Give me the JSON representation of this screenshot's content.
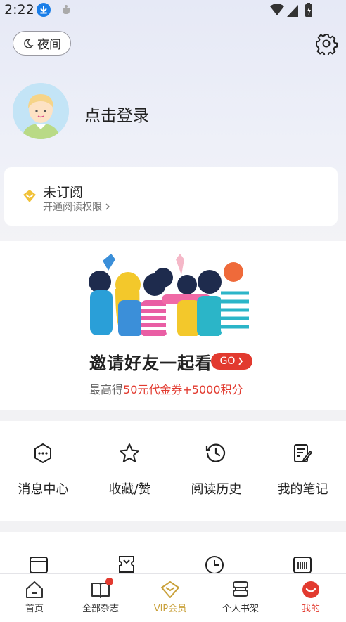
{
  "status_bar": {
    "time": "2:22"
  },
  "header": {
    "night_mode_label": "夜间"
  },
  "profile": {
    "login_text": "点击登录"
  },
  "subscription": {
    "title": "未订阅",
    "subtitle": "开通阅读权限"
  },
  "invite": {
    "title": "邀请好友一起看",
    "go_label": "GO",
    "sub_prefix": "最高得",
    "sub_highlight": "50元代金券+5000积分"
  },
  "quick_actions": [
    {
      "label": "消息中心",
      "icon": "message-icon"
    },
    {
      "label": "收藏/赞",
      "icon": "star-icon"
    },
    {
      "label": "阅读历史",
      "icon": "history-icon"
    },
    {
      "label": "我的笔记",
      "icon": "note-icon"
    }
  ],
  "bottom_nav": [
    {
      "label": "首页",
      "icon": "home-icon"
    },
    {
      "label": "全部杂志",
      "icon": "magazine-icon"
    },
    {
      "label": "VIP会员",
      "icon": "vip-icon"
    },
    {
      "label": "个人书架",
      "icon": "bookshelf-icon"
    },
    {
      "label": "我的",
      "icon": "me-icon"
    }
  ],
  "colors": {
    "accent_red": "#e23a2f",
    "vip_gold": "#c9a13b",
    "text_primary": "#222222",
    "text_secondary": "#777777"
  }
}
